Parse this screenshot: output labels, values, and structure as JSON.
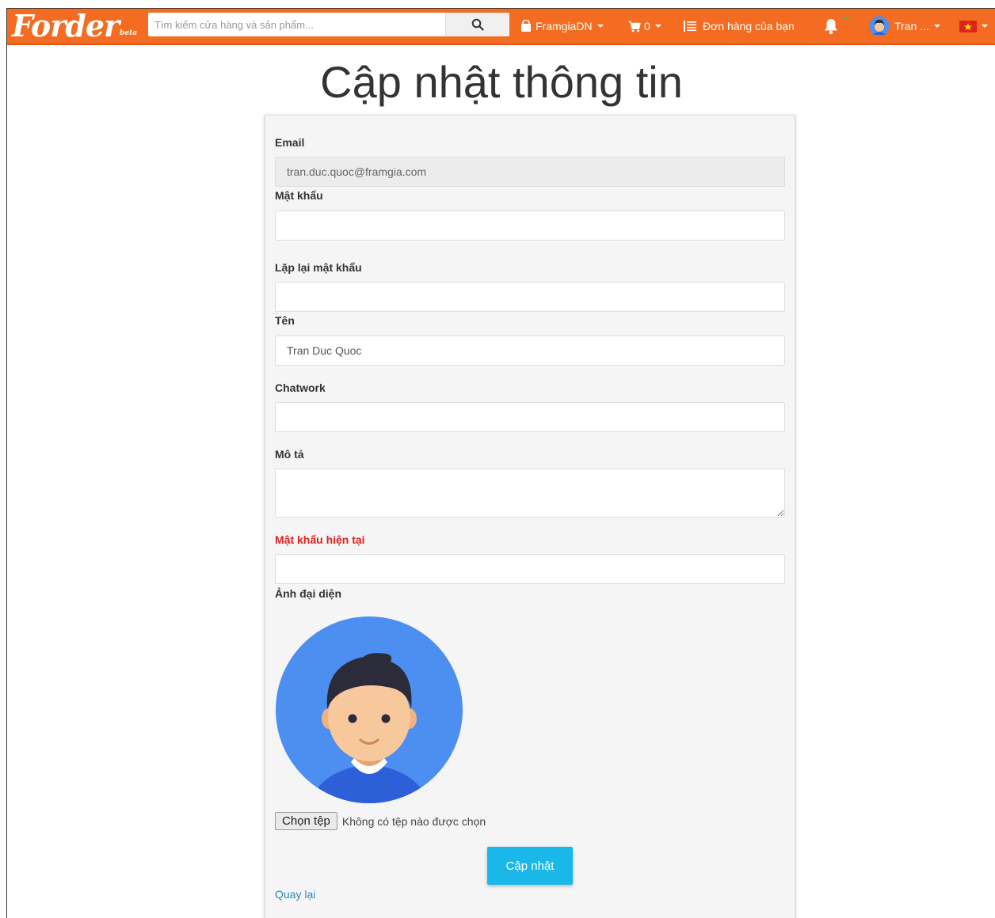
{
  "navbar": {
    "logo_text": "Forder",
    "logo_sub": "beta",
    "search_placeholder": "Tìm kiếm cửa hàng và sản phẩm...",
    "shop_label": "FramgiaDN",
    "cart_count": "0",
    "orders_label": "Đơn hàng của bạn",
    "user_label": "Tran ...",
    "accent_color": "#f36c21",
    "icons": {
      "search": "search-icon",
      "shop": "bag-icon",
      "cart": "cart-icon",
      "orders": "list-icon",
      "bell": "bell-icon",
      "avatar": "user-avatar-icon",
      "language": "vietnam-flag-icon"
    }
  },
  "page": {
    "title": "Cập nhật thông tin"
  },
  "form": {
    "email_label": "Email",
    "email_value": "tran.duc.quoc@framgia.com",
    "password_label": "Mật khẩu",
    "password_value": "",
    "password_confirm_label": "Lặp lại mật khẩu",
    "password_confirm_value": "",
    "name_label": "Tên",
    "name_value": "Tran Duc Quoc",
    "chatwork_label": "Chatwork",
    "chatwork_value": "",
    "description_label": "Mô tả",
    "description_value": "",
    "current_password_label": "Mật khẩu hiện tại",
    "current_password_value": "",
    "avatar_label": "Ảnh đại diện",
    "file_button_label": "Chọn tệp",
    "file_status": "Không có tệp nào được chọn",
    "submit_label": "Cập nhật",
    "back_label": "Quay lại",
    "submit_color": "#1ab8e8",
    "required_label_color": "#e02020"
  }
}
